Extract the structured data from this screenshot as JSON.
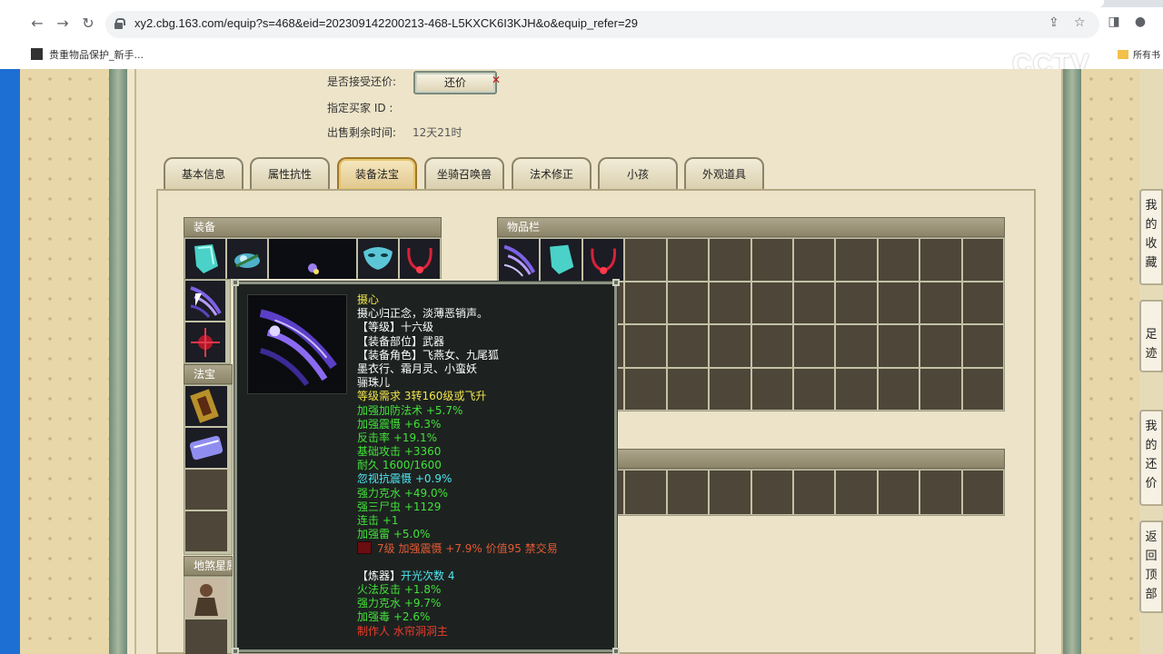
{
  "browser": {
    "url": "xy2.cbg.163.com/equip?s=468&eid=202309142200213-468-L5KXCK6I3KJH&o&equip_refer=29",
    "bookmark": "贵重物品保护_新手...",
    "bookmark_right": "所有书",
    "watermark": "CCTV"
  },
  "info": {
    "counter_offer_label": "是否接受还价:",
    "counter_offer_button": "还价",
    "counter_offer_x": "✕",
    "buyer_label": "指定买家 ID :",
    "time_left_label": "出售剩余时间:",
    "time_left_value": "12天21时"
  },
  "tabs": [
    "基本信息",
    "属性抗性",
    "装备法宝",
    "坐骑召唤兽",
    "法术修正",
    "小孩",
    "外观道具"
  ],
  "sections": {
    "equipment": "装备",
    "inventory": "物品栏",
    "treasure": "法宝",
    "star": "地煞星属"
  },
  "tooltip": {
    "lines": [
      {
        "text": "摄心",
        "color": "yellow"
      },
      {
        "text": "摄心归正念，淡薄恶销声。",
        "color": "white"
      },
      {
        "text": "【等级】十六级",
        "color": "white"
      },
      {
        "text": "【装备部位】武器",
        "color": "white"
      },
      {
        "text": "【装备角色】飞燕女、九尾狐",
        "color": "white"
      },
      {
        "text": "墨衣行、霜月灵、小蛮妖",
        "color": "white"
      },
      {
        "text": "骊珠儿",
        "color": "white"
      },
      {
        "text": "等级需求 3转160级或飞升",
        "color": "yellow"
      },
      {
        "text": "加强加防法术 +5.7%",
        "color": "green"
      },
      {
        "text": "加强震慑 +6.3%",
        "color": "green"
      },
      {
        "text": "反击率 +19.1%",
        "color": "green"
      },
      {
        "text": "基础攻击 +3360",
        "color": "green"
      },
      {
        "text": "耐久 1600/1600",
        "color": "green"
      },
      {
        "text": "忽视抗震慑 +0.9%",
        "color": "cyan"
      },
      {
        "text": "强力克水 +49.0%",
        "color": "green"
      },
      {
        "text": "强三尸虫 +1129",
        "color": "green"
      },
      {
        "text": "连击 +1",
        "color": "green"
      },
      {
        "text": "加强雷 +5.0%",
        "color": "green"
      },
      {
        "text": "7级 加强震慑 +7.9% 价值95 禁交易",
        "color": "redgold",
        "gem": true
      },
      {
        "text": "",
        "color": "white"
      },
      {
        "text": "【炼器】",
        "color": "white",
        "suffix": "开光次数 4",
        "suffix_color": "cyan"
      },
      {
        "text": "火法反击 +1.8%",
        "color": "green"
      },
      {
        "text": "强力克水 +9.7%",
        "color": "green"
      },
      {
        "text": "加强毒 +2.6%",
        "color": "green"
      },
      {
        "text": "制作人 水帘洞洞主",
        "color": "red"
      }
    ]
  },
  "right_side": {
    "favorites": "我的收藏",
    "footprints": "足迹",
    "my_counter": "我的还价",
    "back_top": "返回顶部"
  }
}
